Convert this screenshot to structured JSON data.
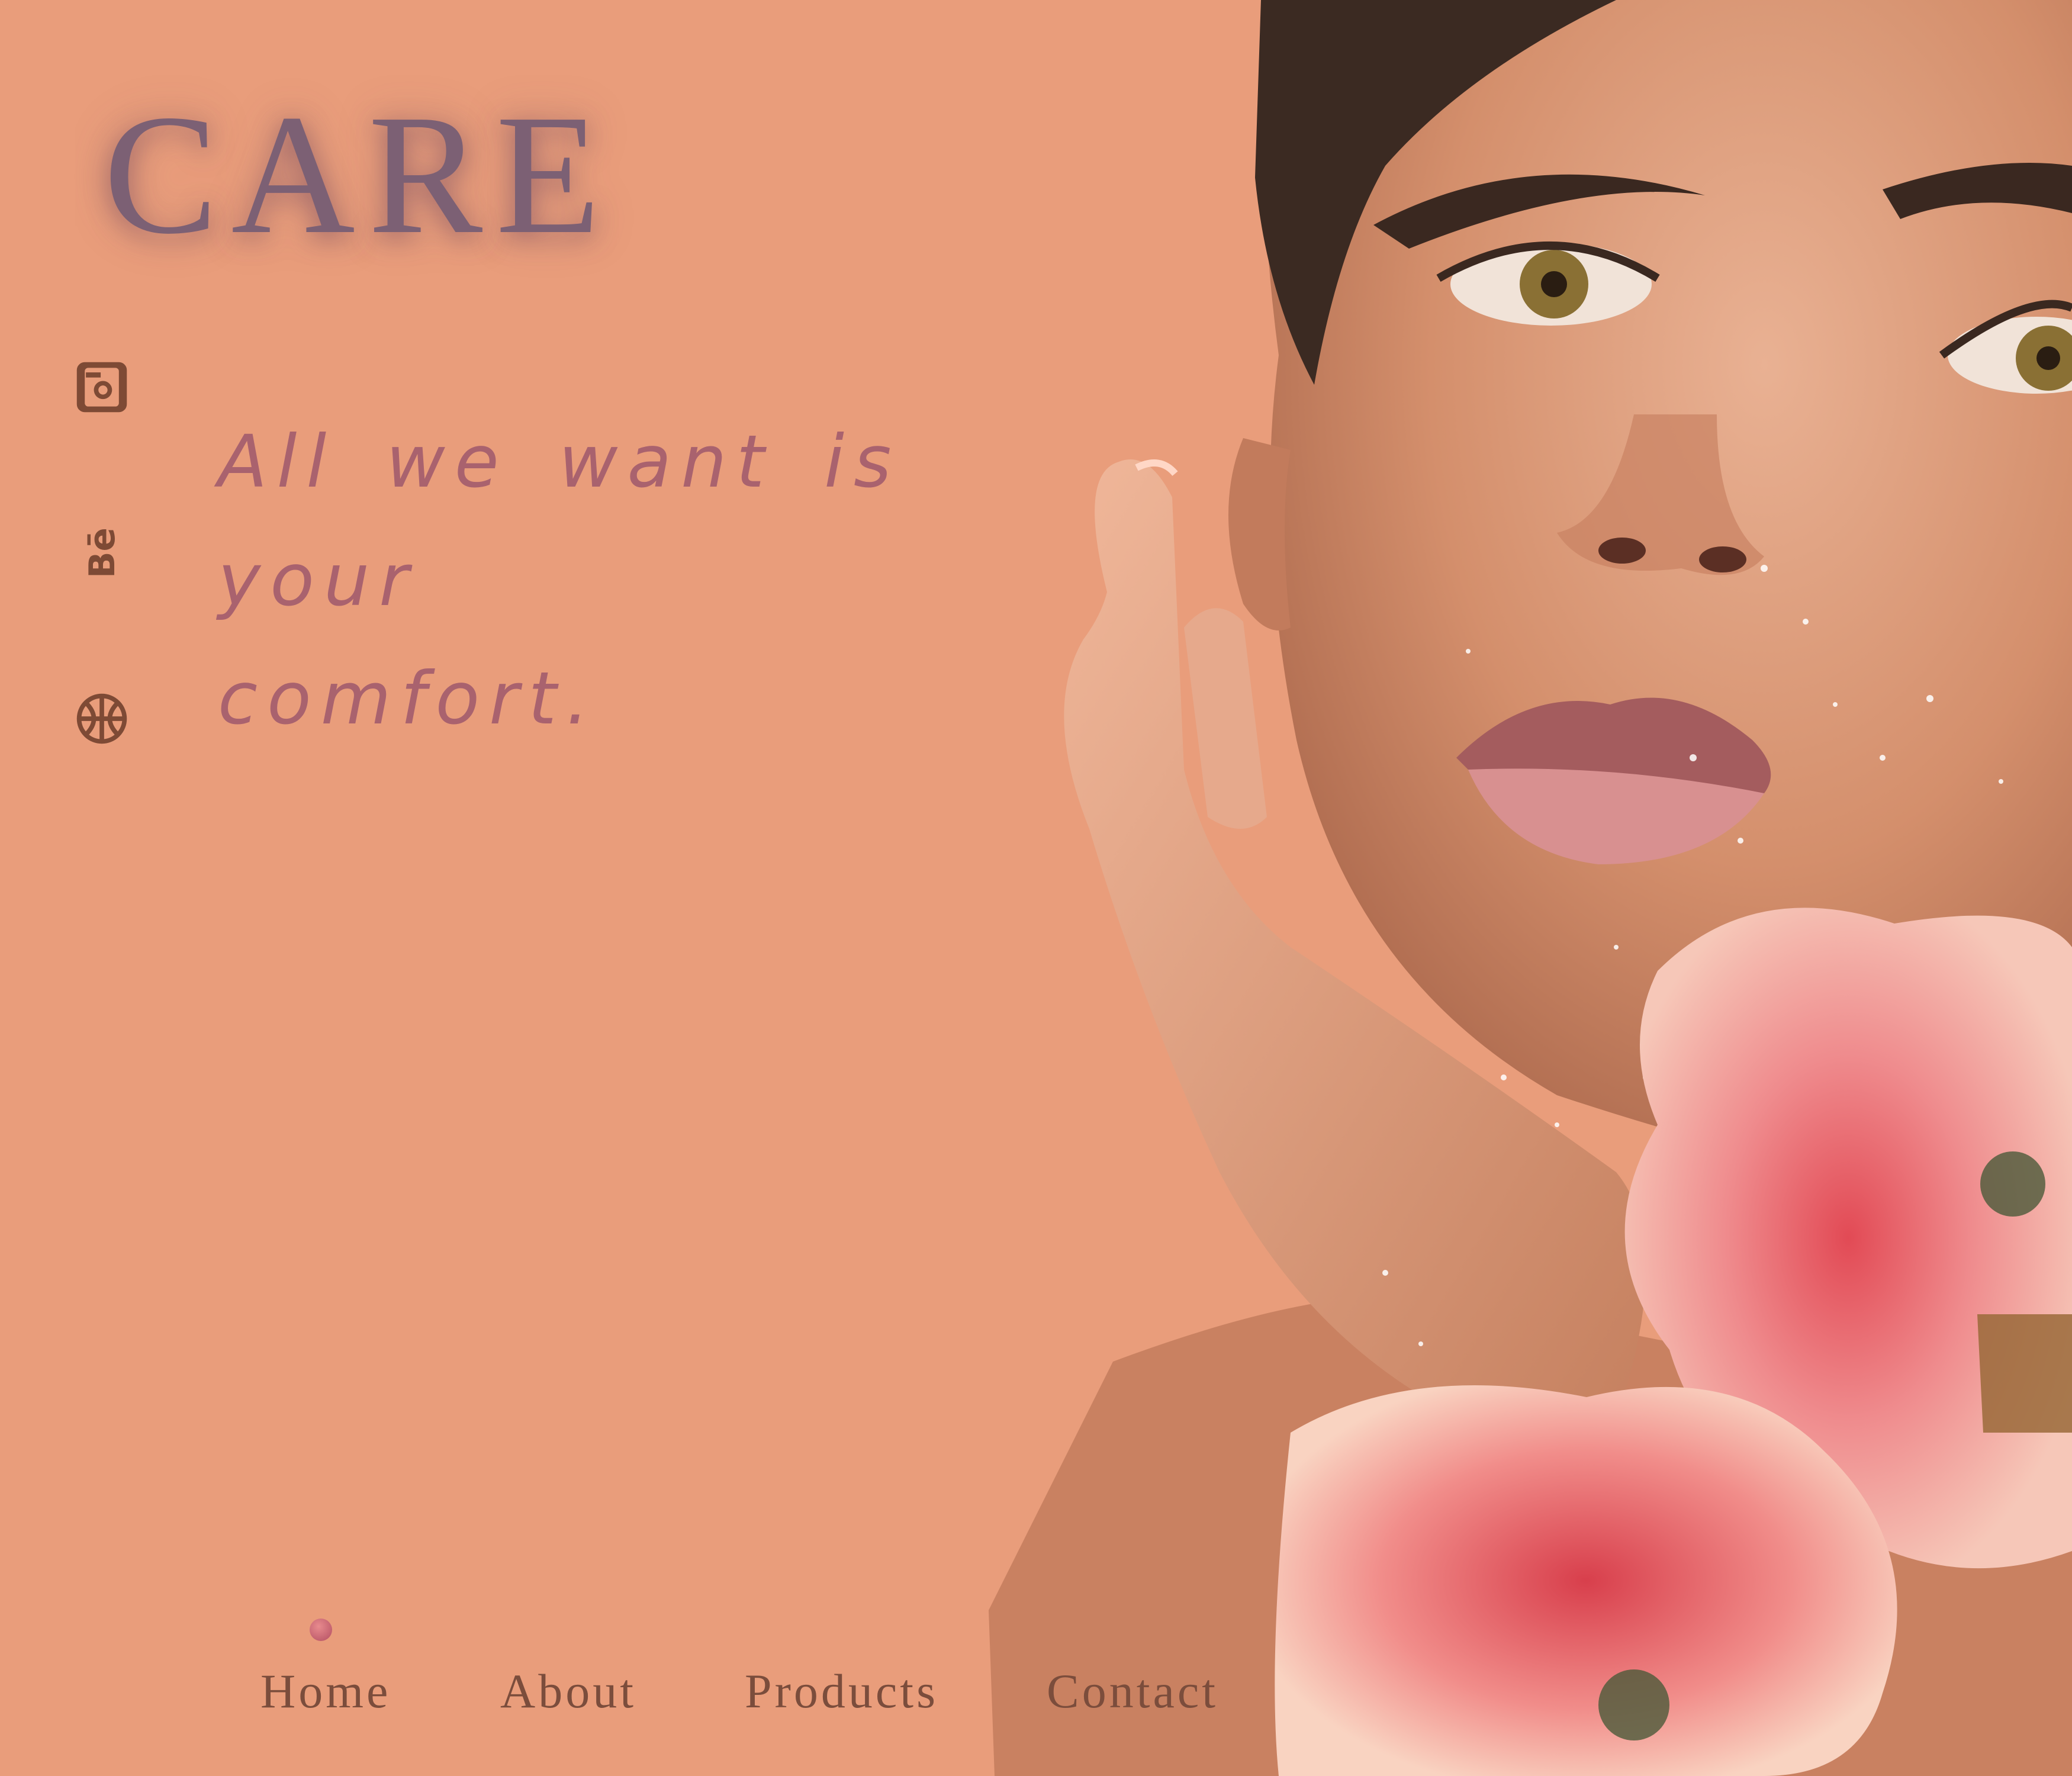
{
  "brand": {
    "title": "CARE"
  },
  "social": [
    {
      "name": "instagram-icon"
    },
    {
      "name": "behance-icon",
      "glyph": "Bē"
    },
    {
      "name": "dribbble-icon"
    }
  ],
  "hero": {
    "tagline_line1": "All we want is your",
    "tagline_line2": "comfort."
  },
  "nav": {
    "items": [
      {
        "label": "Home",
        "active": true
      },
      {
        "label": "About",
        "active": false
      },
      {
        "label": "Products",
        "active": false
      },
      {
        "label": "Contact",
        "active": false
      }
    ]
  },
  "colors": {
    "background": "#e99d7b",
    "brand_text": "#7c6074",
    "tagline_text": "#a9626e",
    "nav_text": "#7b4d3c",
    "icon": "#7e4a35",
    "active_dot": "#c45a6a"
  }
}
